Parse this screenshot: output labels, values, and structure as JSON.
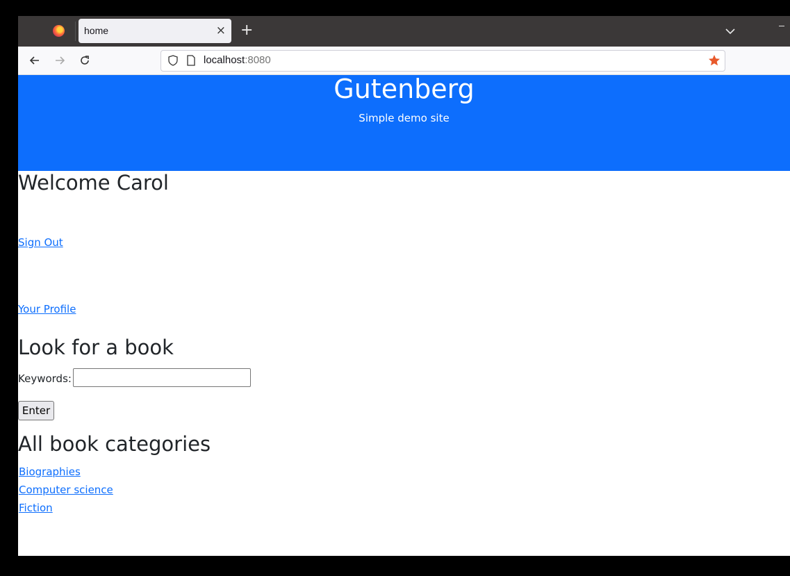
{
  "browser": {
    "tab_title": "home",
    "url_host": "localhost",
    "url_port": ":8080",
    "icons": [
      "firefox-logo",
      "close-icon",
      "plus-icon",
      "chevron-down-icon",
      "back-icon",
      "forward-icon",
      "reload-icon",
      "shield-icon",
      "page-icon",
      "star-icon"
    ],
    "accent": "#0d6efd"
  },
  "hero": {
    "title": "Gutenberg",
    "subtitle": "Simple demo site"
  },
  "welcome": {
    "heading": "Welcome Carol",
    "sign_out": "Sign Out",
    "profile": "Your Profile"
  },
  "search": {
    "heading": "Look for a book",
    "label": "Keywords:",
    "value": "",
    "button": "Enter"
  },
  "categories": {
    "heading": "All book categories",
    "items": [
      "Biographies",
      "Computer science",
      "Fiction"
    ]
  }
}
